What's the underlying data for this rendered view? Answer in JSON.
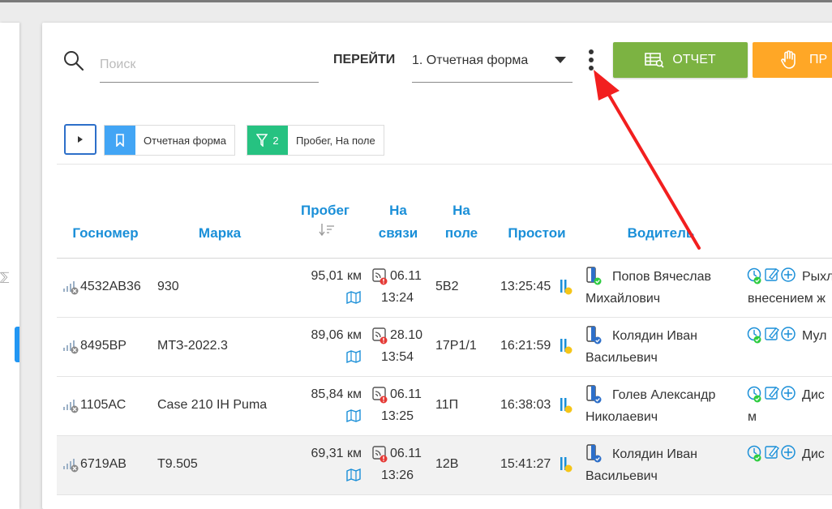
{
  "search": {
    "placeholder": "Поиск"
  },
  "header": {
    "goto_label": "ПЕРЕЙТИ",
    "form_select": "1. Отчетная форма",
    "report_button": "ОТЧЕТ",
    "orange_button": "ПР"
  },
  "filters": {
    "form_chip": "Отчетная форма",
    "filter_count": "2",
    "filter_chip": "Пробег, На поле"
  },
  "columns": {
    "plate": "Госномер",
    "brand": "Марка",
    "mileage": "Пробег",
    "online": "На связи",
    "field": "На поле",
    "idle": "Простои",
    "driver": "Водитель"
  },
  "rows": [
    {
      "plate": "4532АВ36",
      "brand": "930",
      "mileage": "95,01 км",
      "link_date": "06.11",
      "link_time": "13:24",
      "field": "5В2",
      "idle": "13:25:45",
      "driver1": "Попов Вячеслав",
      "driver2": "Михайлович",
      "note1": "Рыхл",
      "note2": "внесением ж"
    },
    {
      "plate": "8495ВР",
      "brand": "МТЗ-2022.3",
      "mileage": "89,06 км",
      "link_date": "28.10",
      "link_time": "13:54",
      "field": "17Р1/1",
      "idle": "16:21:59",
      "driver1": "Колядин Иван",
      "driver2": "Васильевич",
      "note1": "Мул",
      "note2": ""
    },
    {
      "plate": "1105АС",
      "brand": "Case 210 IH Puma",
      "mileage": "85,84 км",
      "link_date": "06.11",
      "link_time": "13:25",
      "field": "11П",
      "idle": "16:38:03",
      "driver1": "Голев Александр",
      "driver2": "Николаевич",
      "note1": "Дис",
      "note2": "м"
    },
    {
      "plate": "6719АВ",
      "brand": "Т9.505",
      "mileage": "69,31 км",
      "link_date": "06.11",
      "link_time": "13:26",
      "field": "12В",
      "idle": "15:41:27",
      "driver1": "Колядин Иван",
      "driver2": "Васильевич",
      "note1": "Дис",
      "note2": ""
    }
  ],
  "colors": {
    "accent": "#1a8fd8",
    "green": "#7cb342",
    "orange": "#ffa726",
    "teal": "#26c281",
    "blue": "#42a5f5",
    "arrow": "#f21f1f"
  }
}
